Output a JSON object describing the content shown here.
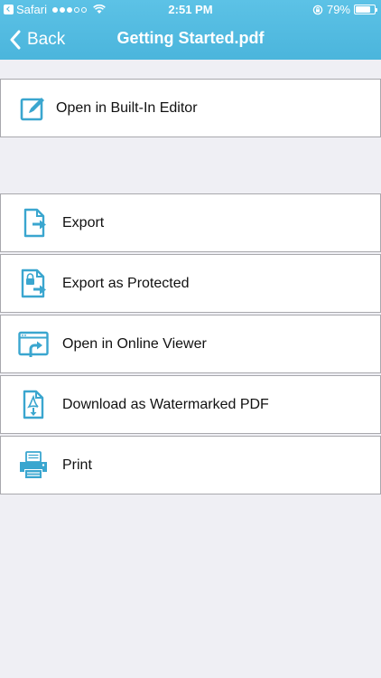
{
  "status_bar": {
    "carrier": "Safari",
    "time": "2:51 PM",
    "battery": "79%",
    "battery_level": 0.79
  },
  "nav": {
    "back_label": "Back",
    "title": "Getting Started.pdf"
  },
  "colors": {
    "accent": "#3aa6cf",
    "header": "#4bb5dc",
    "background": "#efeff4"
  },
  "menu": {
    "editor": {
      "label": "Open in Built-In Editor",
      "icon": "edit-icon"
    },
    "export": {
      "label": "Export",
      "icon": "export-icon"
    },
    "export_protected": {
      "label": "Export as Protected",
      "icon": "export-protected-icon"
    },
    "online_viewer": {
      "label": "Open in Online Viewer",
      "icon": "online-viewer-icon"
    },
    "watermarked": {
      "label": "Download as Watermarked PDF",
      "icon": "pdf-download-icon"
    },
    "print": {
      "label": "Print",
      "icon": "printer-icon"
    }
  }
}
